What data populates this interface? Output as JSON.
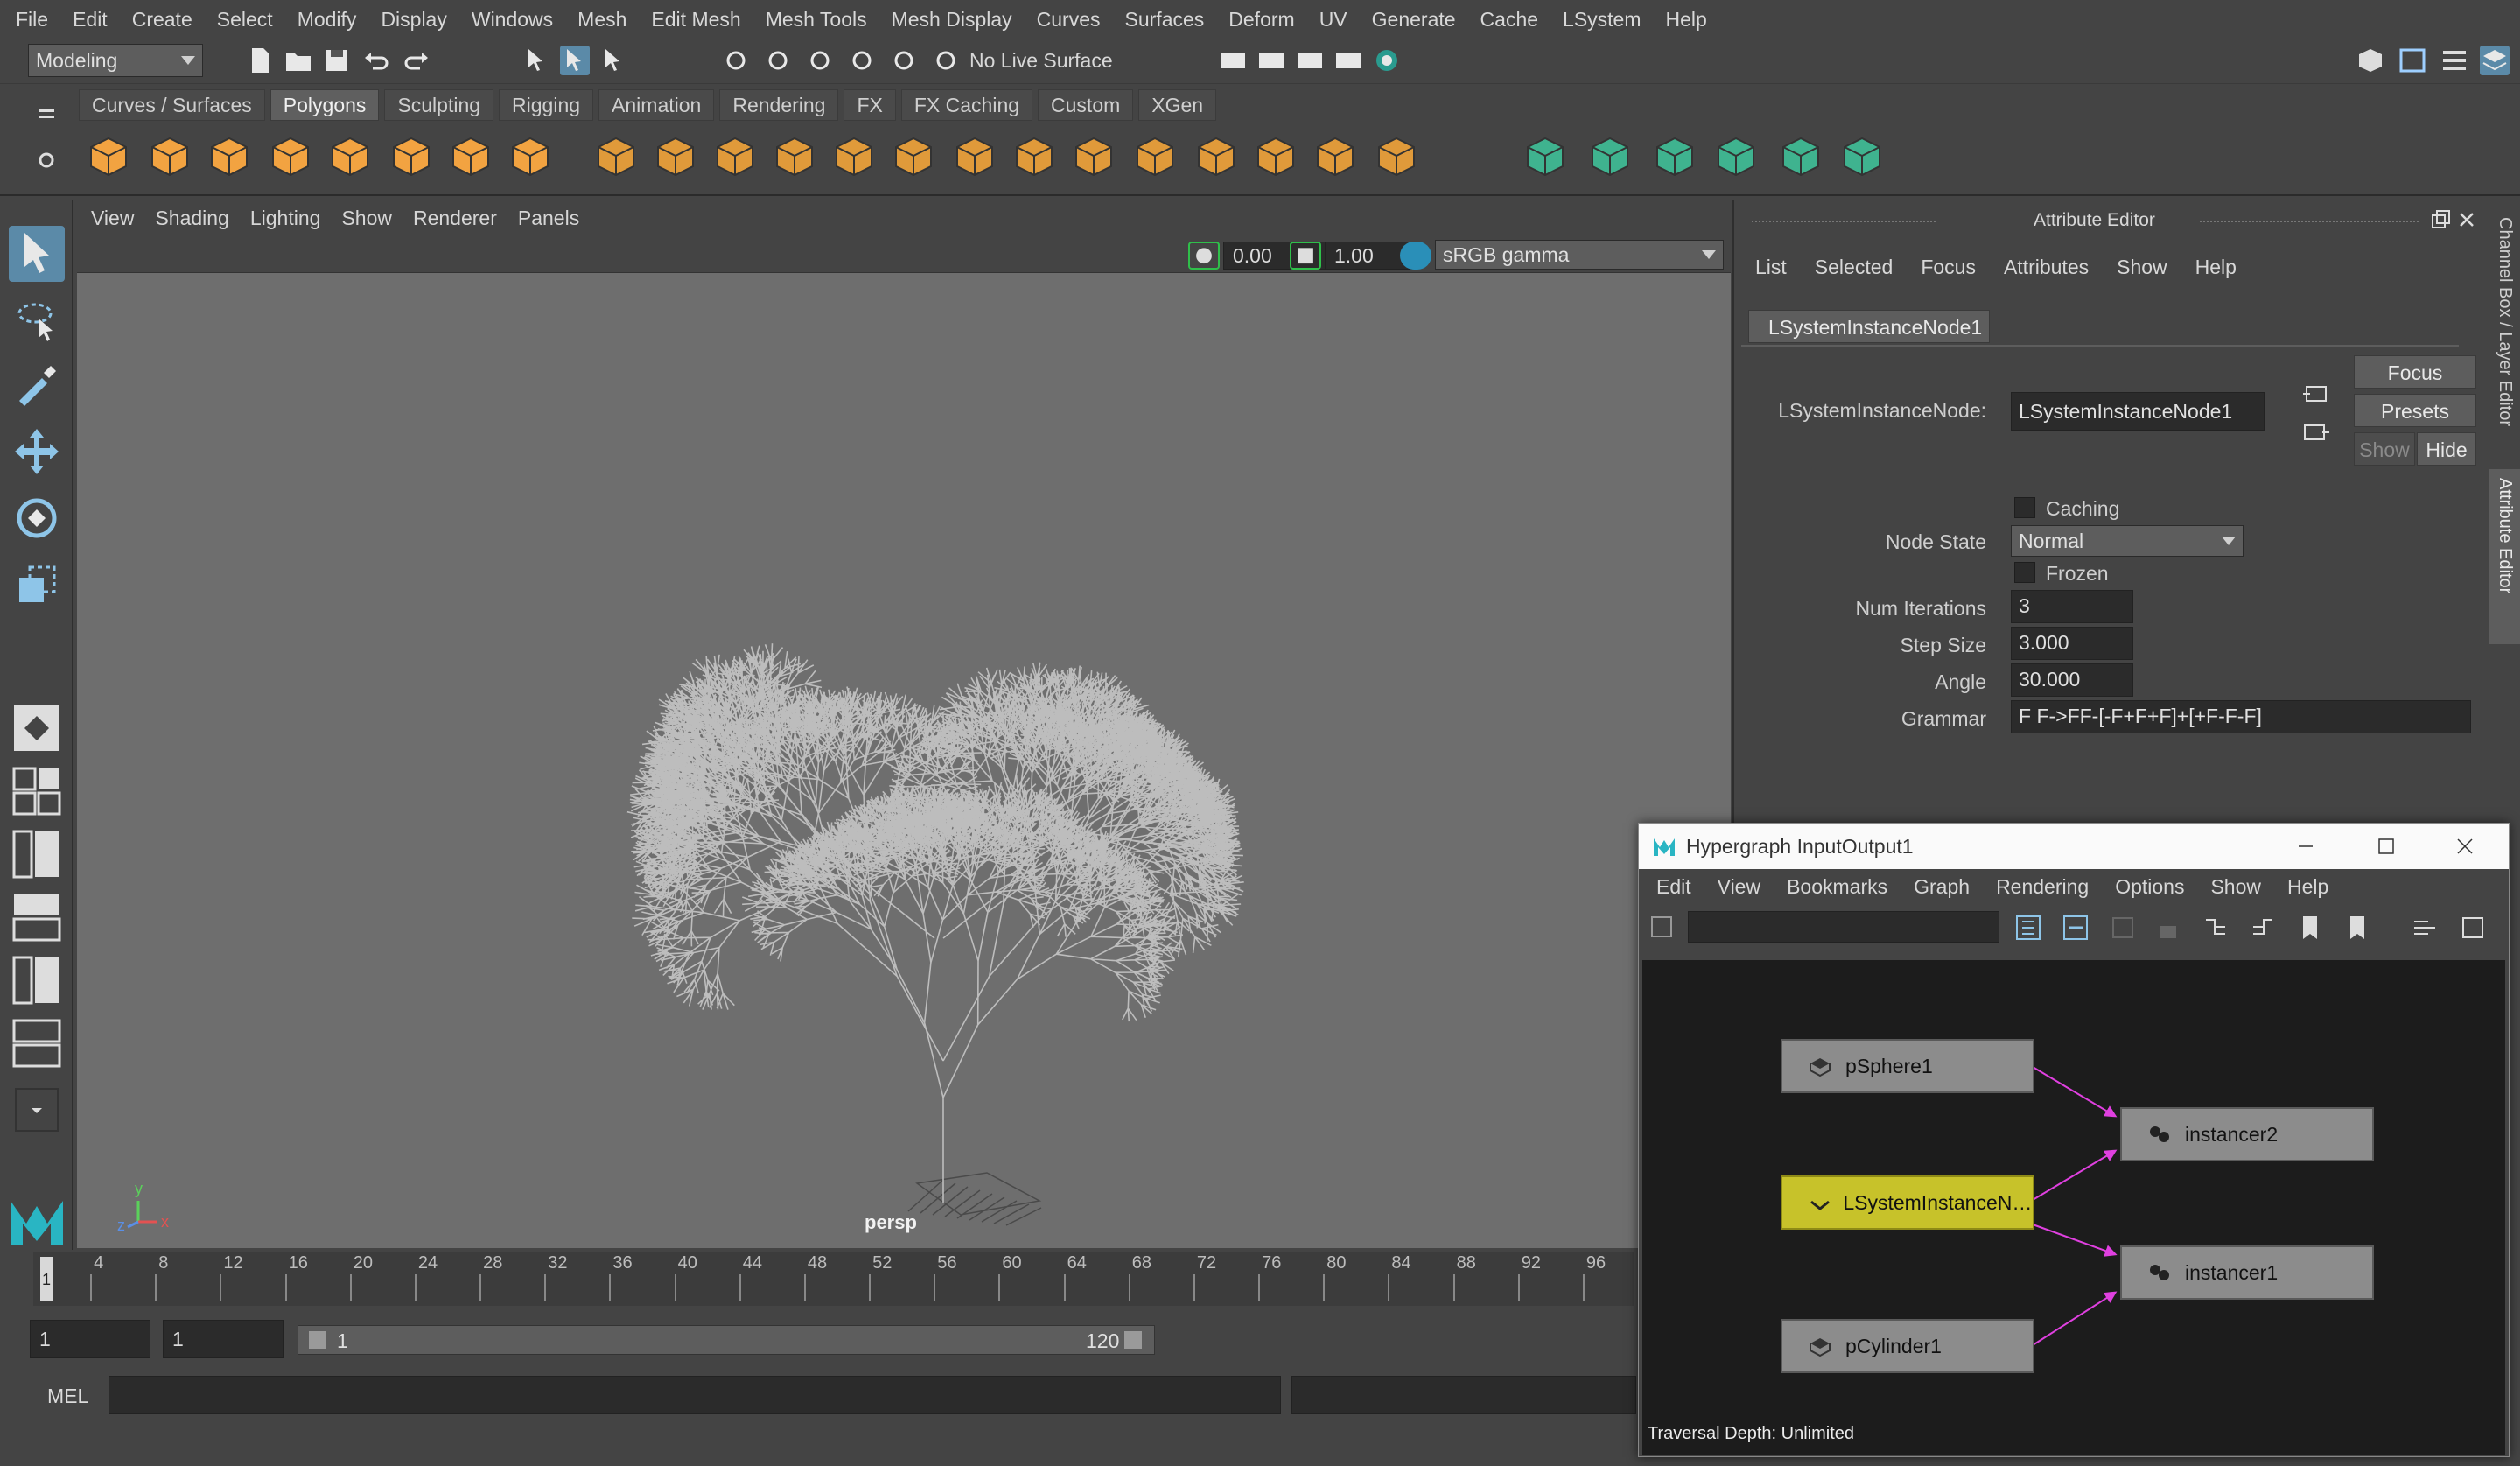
{
  "menubar": [
    "File",
    "Edit",
    "Create",
    "Select",
    "Modify",
    "Display",
    "Windows",
    "Mesh",
    "Edit Mesh",
    "Mesh Tools",
    "Mesh Display",
    "Curves",
    "Surfaces",
    "Deform",
    "UV",
    "Generate",
    "Cache",
    "LSystem",
    "Help"
  ],
  "statusline": {
    "mode": "Modeling",
    "live_surface": "No Live Surface"
  },
  "shelf_tabs": [
    "Curves / Surfaces",
    "Polygons",
    "Sculpting",
    "Rigging",
    "Animation",
    "Rendering",
    "FX",
    "FX Caching",
    "Custom",
    "XGen"
  ],
  "shelf_active": "Polygons",
  "viewport": {
    "menu": [
      "View",
      "Shading",
      "Lighting",
      "Show",
      "Renderer",
      "Panels"
    ],
    "exposure": "0.00",
    "gamma": "1.00",
    "colorspace": "sRGB gamma",
    "camera_label": "persp",
    "axis": {
      "x": "x",
      "y": "y",
      "z": "z"
    }
  },
  "timeline": {
    "ticks": [
      "4",
      "8",
      "12",
      "16",
      "20",
      "24",
      "28",
      "32",
      "36",
      "40",
      "44",
      "48",
      "52",
      "56",
      "60",
      "64",
      "68",
      "72",
      "76",
      "80",
      "84",
      "88",
      "92",
      "96"
    ],
    "current": "1"
  },
  "range": {
    "start": "1",
    "anim_start": "1",
    "range_start": "1",
    "range_end": "120"
  },
  "cmdline": {
    "label": "MEL"
  },
  "attribute_editor": {
    "title": "Attribute Editor",
    "menu": [
      "List",
      "Selected",
      "Focus",
      "Attributes",
      "Show",
      "Help"
    ],
    "tab": "LSystemInstanceNode1",
    "node_label": "LSystemInstanceNode:",
    "node_value": "LSystemInstanceNode1",
    "buttons": {
      "focus": "Focus",
      "presets": "Presets",
      "show": "Show",
      "hide": "Hide"
    },
    "caching_label": "Caching",
    "node_state_label": "Node State",
    "node_state_value": "Normal",
    "frozen_label": "Frozen",
    "num_iterations_label": "Num Iterations",
    "num_iterations_value": "3",
    "step_size_label": "Step Size",
    "step_size_value": "3.000",
    "angle_label": "Angle",
    "angle_value": "30.000",
    "grammar_label": "Grammar",
    "grammar_value": "F F->FF-[-F+F+F]+[+F-F-F]",
    "side_tab_channel": "Channel Box / Layer Editor",
    "side_tab_ae": "Attribute Editor"
  },
  "hypergraph": {
    "title": "Hypergraph InputOutput1",
    "menu": [
      "Edit",
      "View",
      "Bookmarks",
      "Graph",
      "Rendering",
      "Options",
      "Show",
      "Help"
    ],
    "nodes": {
      "psphere": "pSphere1",
      "lsystem": "LSystemInstanceNod...",
      "pcylinder": "pCylinder1",
      "instancer2": "instancer2",
      "instancer1": "instancer1"
    },
    "footer": "Traversal Depth: Unlimited",
    "colors": {
      "selected": "#c7c22a",
      "edge": "#e040e0"
    }
  }
}
